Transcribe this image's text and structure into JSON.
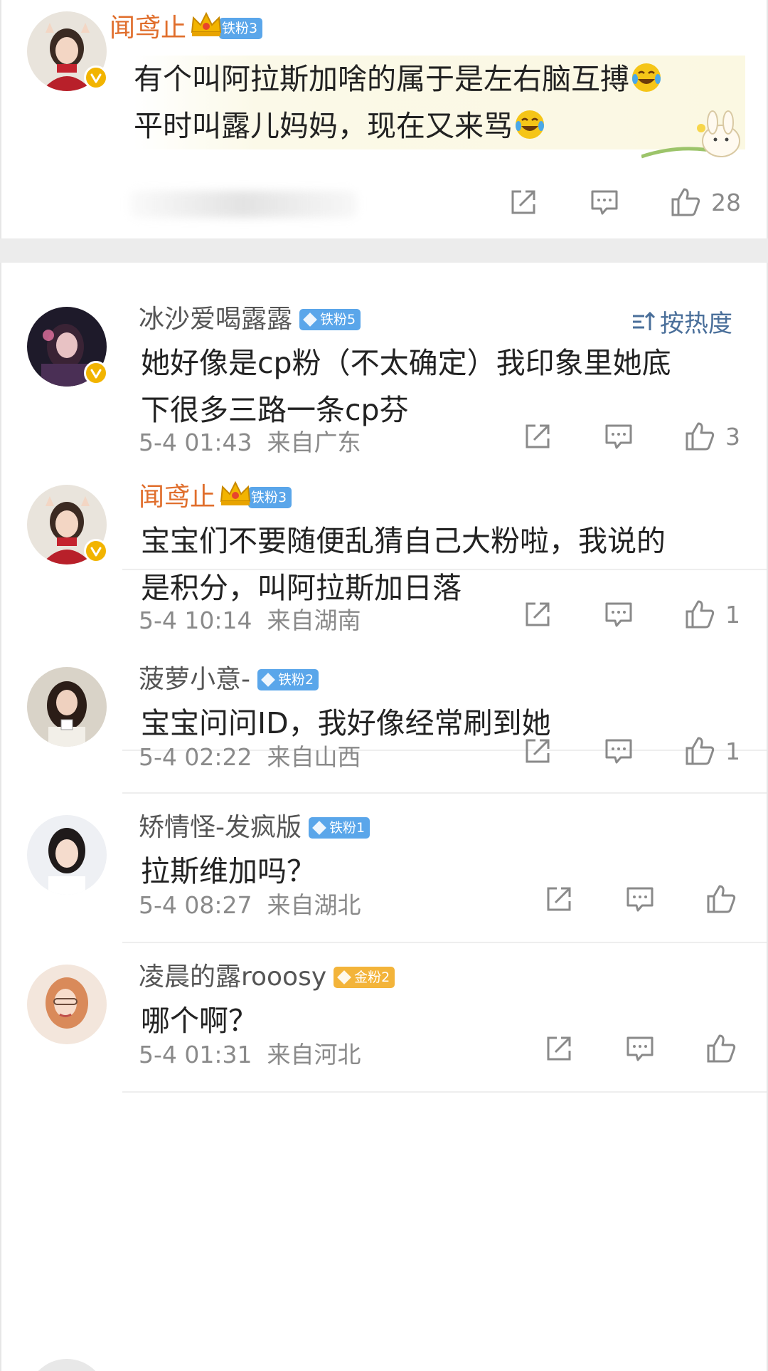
{
  "top_comment": {
    "username": "闻鸢止",
    "fan_badge": "铁粉3",
    "line1": "有个叫阿拉斯加啥的属于是左右脑互搏",
    "line2": "平时叫露儿妈妈，现在又来骂",
    "likes": "28"
  },
  "sort": {
    "label": "按热度"
  },
  "replies": [
    {
      "username": "冰沙爱喝露露",
      "fan_badge": "铁粉5",
      "lines": [
        "她好像是cp粉（不太确定）我印象里她底",
        "下很多三路一条cp芬"
      ],
      "time": "5-4 01:43",
      "location": "来自广东",
      "likes": "3"
    },
    {
      "username": "闻鸢止",
      "fan_badge": "铁粉3",
      "lines": [
        "宝宝们不要随便乱猜自己大粉啦，我说的",
        "是积分，叫阿拉斯加日落"
      ],
      "time": "5-4 10:14",
      "location": "来自湖南",
      "likes": "1"
    },
    {
      "username": "菠萝小意-",
      "fan_badge": "铁粉2",
      "lines": [
        "宝宝问问ID，我好像经常刷到她"
      ],
      "time": "5-4 02:22",
      "location": "来自山西",
      "likes": "1"
    },
    {
      "username": "矫情怪-发疯版",
      "fan_badge": "铁粉1",
      "lines": [
        "拉斯维加吗？"
      ],
      "time": "5-4 08:27",
      "location": "来自湖北",
      "likes": ""
    },
    {
      "username": "凌晨的露rooosy",
      "fan_badge": "金粉2",
      "lines": [
        "哪个啊？"
      ],
      "time": "5-4 01:31",
      "location": "来自河北",
      "likes": ""
    }
  ],
  "icons": {
    "share": "share-icon",
    "comment": "comment-icon",
    "like": "thumbs-up-icon",
    "verified": "verified-badge-icon",
    "sort": "sort-icon"
  },
  "colors": {
    "username_highlight": "#e06e2c",
    "fan_badge_blue": "#5aa6ea",
    "fan_badge_gold": "#f3b43a",
    "verified": "#f2b400",
    "sort_link": "#4a6f9a"
  }
}
